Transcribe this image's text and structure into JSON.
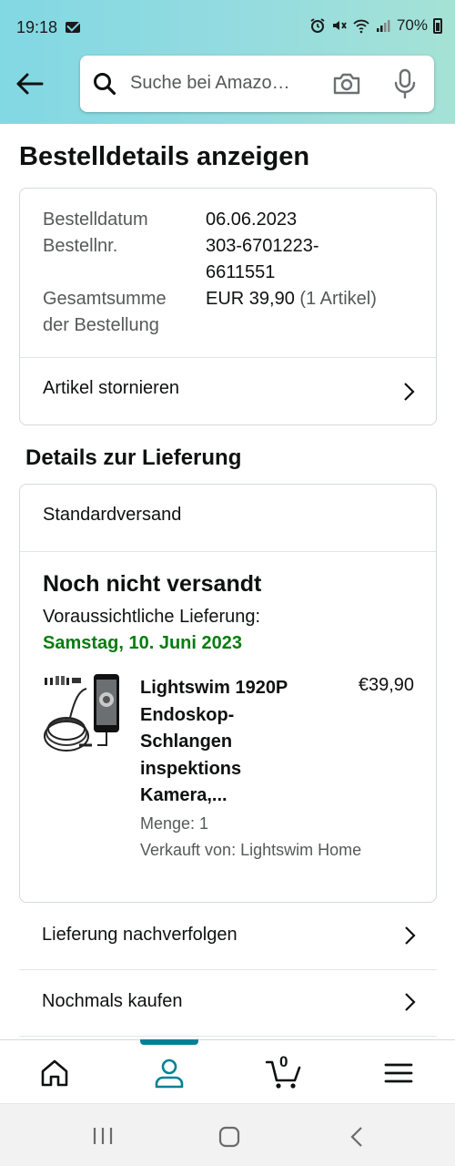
{
  "status_bar": {
    "time": "19:18",
    "battery": "70%"
  },
  "header": {
    "search_placeholder": "Suche bei Amazo…"
  },
  "page_title": "Bestelldetails anzeigen",
  "order_summary": {
    "date_label": "Bestelldatum",
    "date_value": "06.06.2023",
    "number_label": "Bestellnr.",
    "number_value_line1": "303-6701223-",
    "number_value_line2": "6611551",
    "total_label_line1": "Gesamtsumme",
    "total_label_line2": "der Bestellung",
    "total_value": "EUR 39,90",
    "total_count": "(1 Artikel)",
    "cancel_label": "Artikel stornieren"
  },
  "delivery": {
    "section_title": "Details zur Lieferung",
    "shipping_type": "Standardversand",
    "status": "Noch nicht versandt",
    "eta_label": "Voraussichtliche Lieferung:",
    "eta_date": "Samstag, 10. Juni 2023",
    "product": {
      "title_lines": [
        "Lightswim 1920P",
        "Endoskop-",
        "Schlangen",
        "inspektions",
        "Kamera,..."
      ],
      "price": "€39,90",
      "quantity": "Menge: 1",
      "seller": "Verkauft von: Lightswim Home"
    }
  },
  "actions": {
    "track": "Lieferung nachverfolgen",
    "buy_again": "Nochmals kaufen"
  },
  "bottom_nav": {
    "cart_count": "0",
    "active": "account"
  },
  "colors": {
    "header_gradient_start": "#82d8e3",
    "header_gradient_end": "#a5e2d6",
    "delivery_green": "#067d0e",
    "nav_active": "#008296"
  }
}
